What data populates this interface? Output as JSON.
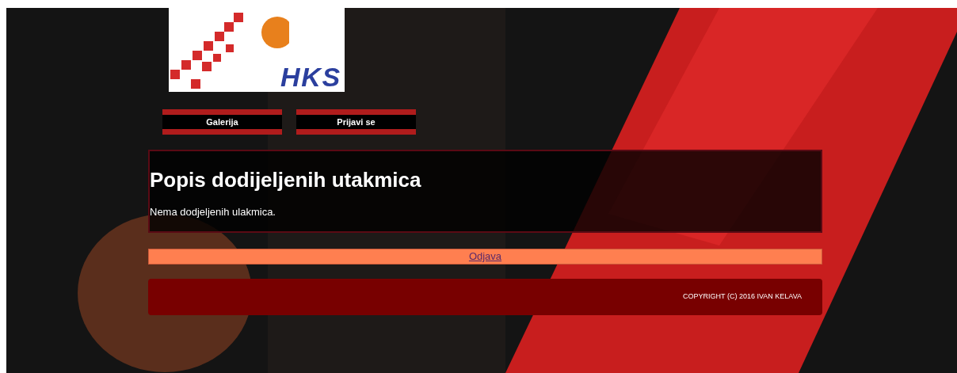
{
  "logo": {
    "text": "HKS"
  },
  "nav": [
    {
      "label": "Galerija"
    },
    {
      "label": "Prijavi se"
    }
  ],
  "content": {
    "title": "Popis dodijeljenih utakmica",
    "message": "Nema dodjeljenih ulakmica."
  },
  "logout": {
    "label": "Odjava"
  },
  "footer": {
    "text": "COPYRIGHT (C) 2016 IVAN KELAVA"
  }
}
